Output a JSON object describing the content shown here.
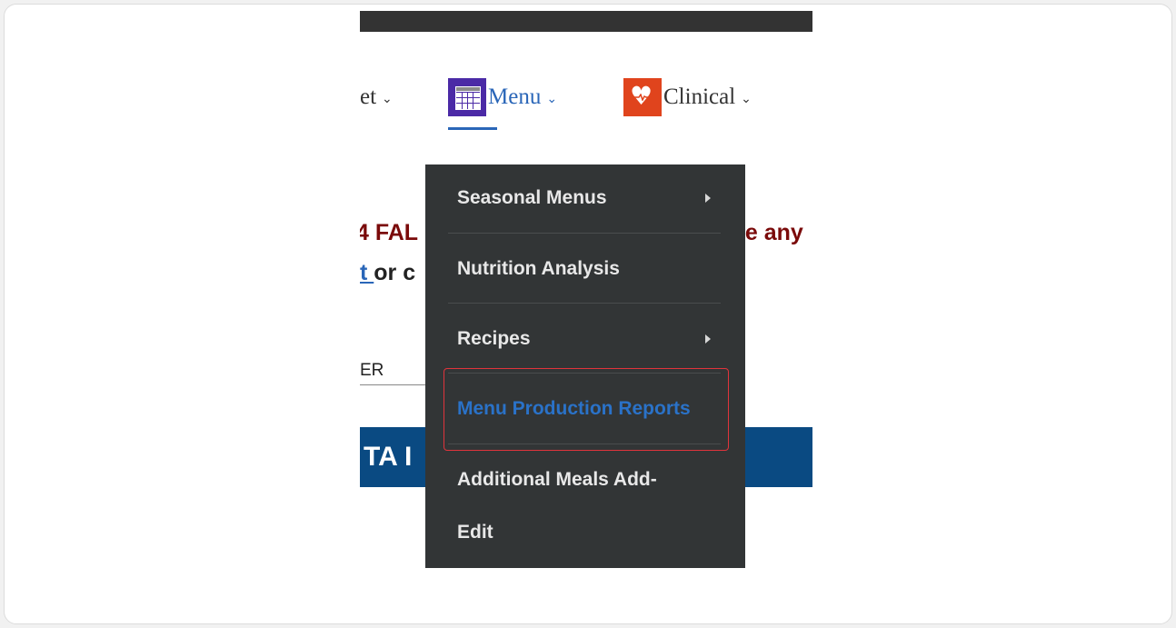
{
  "nav": {
    "market_partial": "et",
    "menu_label": "Menu",
    "clinical_label": "Clinical",
    "chevron": "⌄"
  },
  "background": {
    "red_text_left": "4 FAL",
    "red_text_right": "ve any",
    "link_partial": "t ",
    "link_after": "or c",
    "field_value": "ER",
    "banner_text": "TA I"
  },
  "dropdown": {
    "items": [
      {
        "label": "Seasonal Menus",
        "has_submenu": true
      },
      {
        "label": "Nutrition Analysis",
        "has_submenu": false
      },
      {
        "label": "Recipes",
        "has_submenu": true
      },
      {
        "label": "Menu Production Reports",
        "has_submenu": false,
        "active": true
      },
      {
        "label": "Additional Meals Add-",
        "has_submenu": false
      },
      {
        "label": "Edit",
        "has_submenu": false
      }
    ]
  },
  "colors": {
    "accent": "#2a66b8",
    "menu_icon": "#4b2aa6",
    "clinical_icon": "#e0441d",
    "dropdown_bg": "#323536",
    "highlight": "#e0343c",
    "banner": "#0a4a82"
  },
  "icons": {
    "menu": "calendar-icon",
    "clinical": "heart-pulse-icon"
  }
}
